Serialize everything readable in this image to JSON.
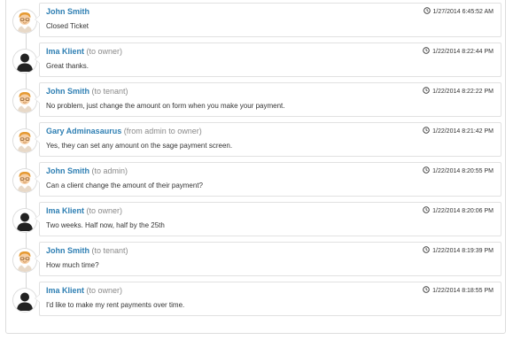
{
  "entries": [
    {
      "author": "John Smith",
      "role": "",
      "date": "1/27/2014 6:45:52 AM",
      "message": "Closed Ticket",
      "avatar": "staff-avatar"
    },
    {
      "author": "Ima Klient",
      "role": "(to owner)",
      "date": "1/22/2014 8:22:44 PM",
      "message": "Great thanks.",
      "avatar": "client-avatar"
    },
    {
      "author": "John Smith",
      "role": "(to tenant)",
      "date": "1/22/2014 8:22:22 PM",
      "message": "No problem, just change the amount on form when you make your payment.",
      "avatar": "staff-avatar"
    },
    {
      "author": "Gary Adminasaurus",
      "role": "(from admin to owner)",
      "date": "1/22/2014 8:21:42 PM",
      "message": "Yes, they can set any amount on the sage payment screen.",
      "avatar": "staff-avatar"
    },
    {
      "author": "John Smith",
      "role": "(to admin)",
      "date": "1/22/2014 8:20:55 PM",
      "message": "Can a client change the amount of their payment?",
      "avatar": "staff-avatar"
    },
    {
      "author": "Ima Klient",
      "role": "(to owner)",
      "date": "1/22/2014 8:20:06 PM",
      "message": "Two weeks. Half now, half by the 25th",
      "avatar": "client-avatar"
    },
    {
      "author": "John Smith",
      "role": "(to tenant)",
      "date": "1/22/2014 8:19:39 PM",
      "message": "How much time?",
      "avatar": "staff-avatar"
    },
    {
      "author": "Ima Klient",
      "role": "(to owner)",
      "date": "1/22/2014 8:18:55 PM",
      "message": "I'd like to make my rent payments over time.",
      "avatar": "client-avatar"
    }
  ],
  "colors": {
    "author": "#2e7fb3",
    "role": "#8a8a8a",
    "border": "#e1e1e1"
  },
  "icons": {
    "timestamp": "clock-icon"
  }
}
